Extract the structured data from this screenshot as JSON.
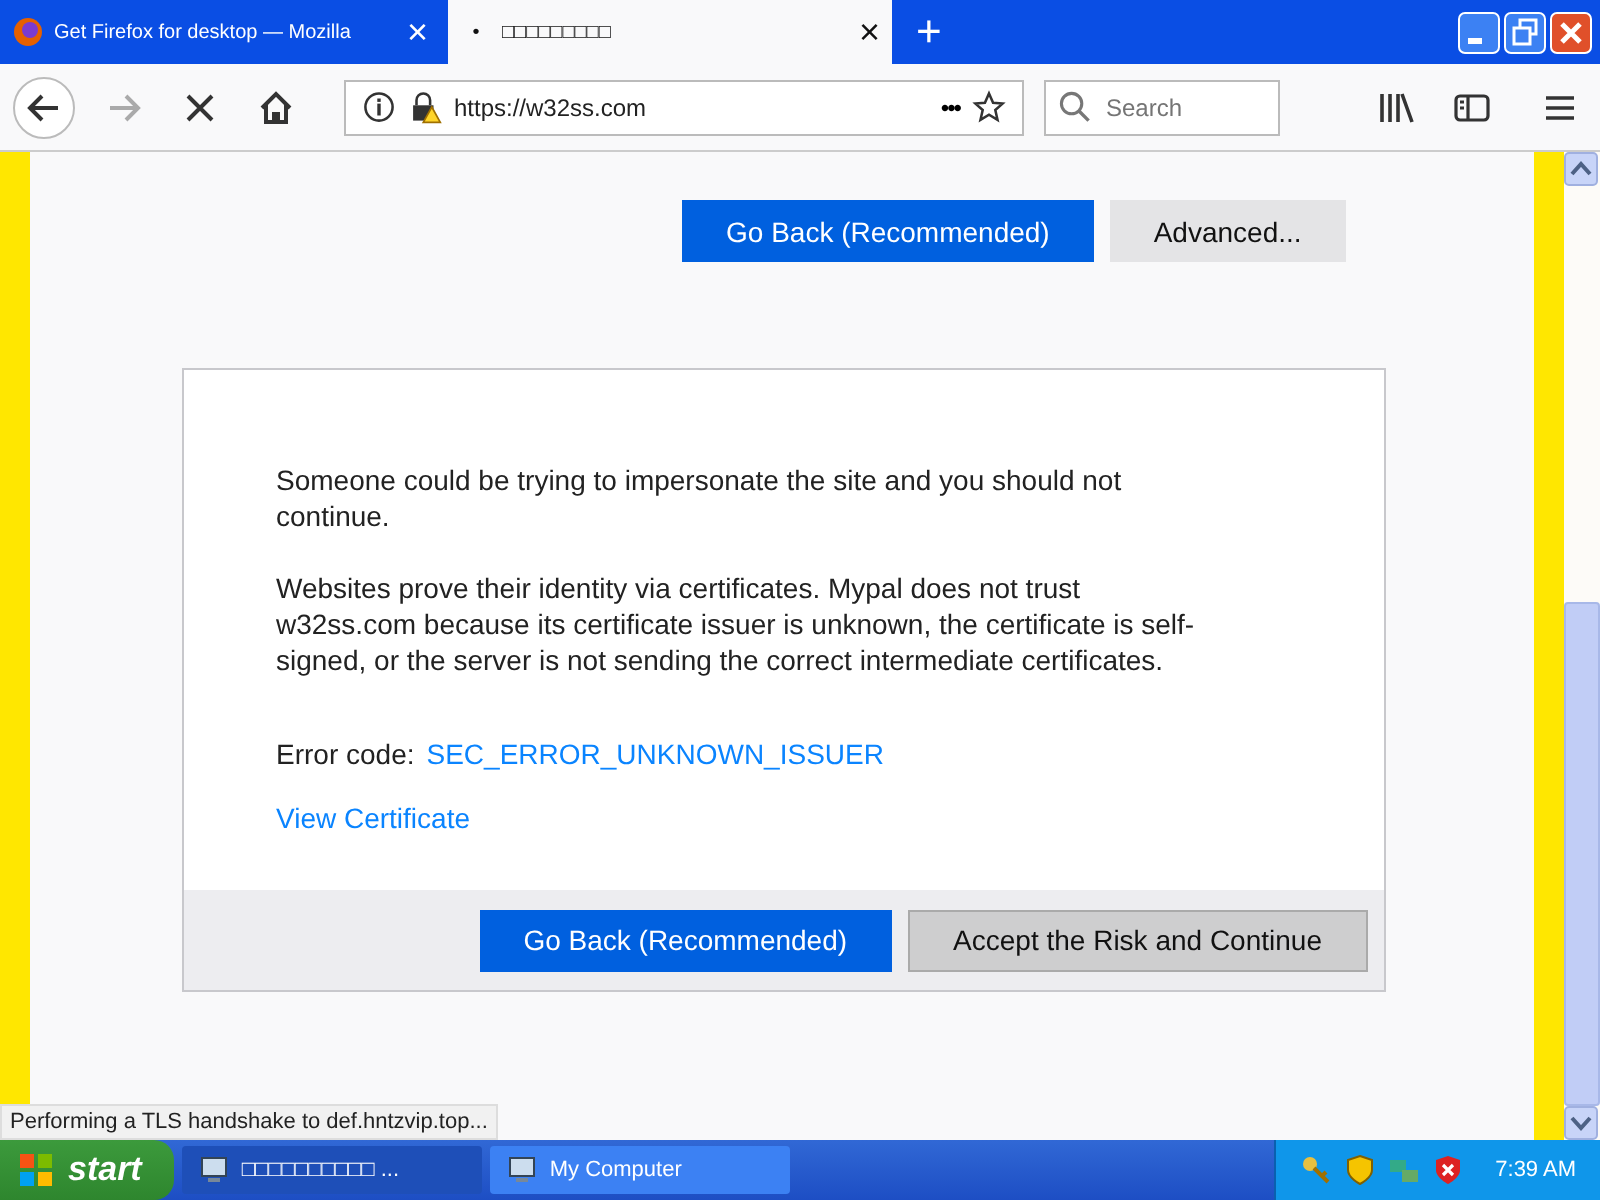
{
  "tabs": [
    {
      "title": "Get Firefox for desktop — Mozilla",
      "selected": false,
      "close": "×"
    },
    {
      "title": "□□□□□□□□□",
      "selected": true,
      "indicator": "•",
      "close": "×"
    }
  ],
  "new_tab": "+",
  "nav": {
    "url": "https://w32ss.com",
    "page_actions": "•••",
    "search_placeholder": "Search"
  },
  "top_buttons": [
    {
      "label": "Go Back (Recommended)",
      "kind": "primary"
    },
    {
      "label": "Advanced...",
      "kind": "secondary"
    }
  ],
  "panel": {
    "paragraphs": [
      "Someone could be trying to impersonate the site and you should not continue.",
      "Websites prove their identity via certificates. Mypal does not trust w32ss.com because its certificate issuer is unknown, the certificate is self-signed, or the server is not sending the correct intermediate certificates."
    ],
    "error_label": "Error code:",
    "error_code": "SEC_ERROR_UNKNOWN_ISSUER",
    "view_certificate": "View Certificate",
    "buttons": [
      {
        "label": "Go Back (Recommended)",
        "kind": "primary"
      },
      {
        "label": "Accept the Risk and Continue",
        "kind": "secondary"
      }
    ]
  },
  "status_bar": "Performing a TLS handshake to def.hntzvip.top...",
  "taskbar": {
    "start": "start",
    "tasks": [
      {
        "label": "□□□□□□□□□□ ...",
        "selected": false
      },
      {
        "label": "My Computer",
        "selected": true
      }
    ],
    "clock": "7:39 AM"
  }
}
